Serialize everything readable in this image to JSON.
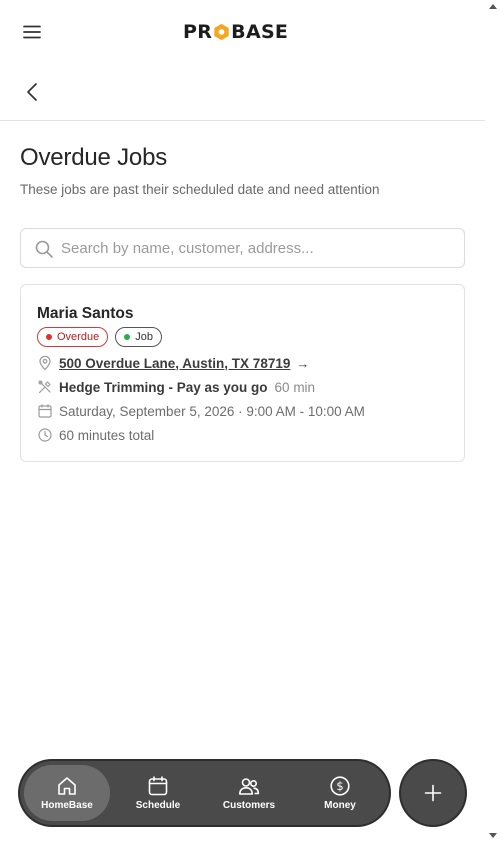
{
  "header": {
    "logo_left": "PR",
    "logo_right": "BASE",
    "menu_icon": "hamburger-menu-icon",
    "back_icon": "chevron-left-icon"
  },
  "page": {
    "title": "Overdue Jobs",
    "subtitle": "These jobs are past their scheduled date and need attention"
  },
  "search": {
    "placeholder": "Search by name, customer, address...",
    "value": ""
  },
  "jobs": [
    {
      "customer": "Maria Santos",
      "badges": [
        "Overdue",
        "Job"
      ],
      "address": "500 Overdue Lane, Austin, TX 78719",
      "address_arrow": "→",
      "service": "Hedge Trimming - Pay as you go",
      "duration": "60 min",
      "schedule": "Saturday, September 5, 2026 · 9:00 AM - 10:00 AM",
      "total": "60 minutes total"
    }
  ],
  "bottom_nav": {
    "items": [
      {
        "label": "HomeBase",
        "icon": "home-icon",
        "active": true
      },
      {
        "label": "Schedule",
        "icon": "calendar-icon",
        "active": false
      },
      {
        "label": "Customers",
        "icon": "users-icon",
        "active": false
      },
      {
        "label": "Money",
        "icon": "dollar-circle-icon",
        "active": false
      }
    ],
    "fab_icon": "plus-icon"
  },
  "colors": {
    "overdue": "#e0302f",
    "job_dot": "#22b24c",
    "logo_accent": "#f5a623",
    "nav_bg": "#4a4a4a",
    "nav_active": "#6c6c6c"
  }
}
